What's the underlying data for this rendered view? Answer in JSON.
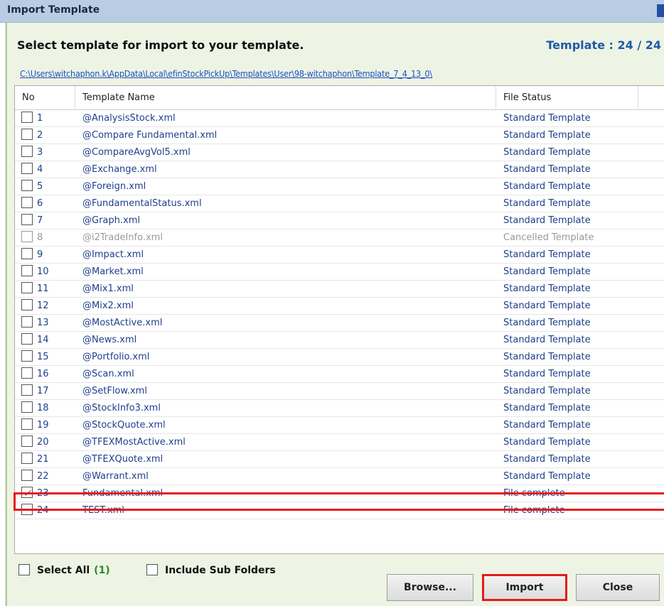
{
  "window": {
    "title": "Import Template"
  },
  "header": {
    "instruction": "Select template for import to your template.",
    "template_count": "Template : 24 / 24",
    "path": "C:\\Users\\witchaphon.k\\AppData\\Local\\efinStockPickUp\\Templates\\User\\98-witchaphon\\Template_7_4_13_0\\"
  },
  "table": {
    "columns": [
      "No",
      "Template Name",
      "File Status"
    ],
    "rows": [
      {
        "no": "1",
        "name": "@AnalysisStock.xml",
        "status": "Standard Template",
        "checked": false
      },
      {
        "no": "2",
        "name": "@Compare Fundamental.xml",
        "status": "Standard Template",
        "checked": false
      },
      {
        "no": "3",
        "name": "@CompareAvgVol5.xml",
        "status": "Standard Template",
        "checked": false
      },
      {
        "no": "4",
        "name": "@Exchange.xml",
        "status": "Standard Template",
        "checked": false
      },
      {
        "no": "5",
        "name": "@Foreign.xml",
        "status": "Standard Template",
        "checked": false
      },
      {
        "no": "6",
        "name": "@FundamentalStatus.xml",
        "status": "Standard Template",
        "checked": false
      },
      {
        "no": "7",
        "name": "@Graph.xml",
        "status": "Standard Template",
        "checked": false
      },
      {
        "no": "8",
        "name": "@i2TradeInfo.xml",
        "status": "Cancelled Template",
        "checked": false
      },
      {
        "no": "9",
        "name": "@Impact.xml",
        "status": "Standard Template",
        "checked": false
      },
      {
        "no": "10",
        "name": "@Market.xml",
        "status": "Standard Template",
        "checked": false
      },
      {
        "no": "11",
        "name": "@Mix1.xml",
        "status": "Standard Template",
        "checked": false
      },
      {
        "no": "12",
        "name": "@Mix2.xml",
        "status": "Standard Template",
        "checked": false
      },
      {
        "no": "13",
        "name": "@MostActive.xml",
        "status": "Standard Template",
        "checked": false
      },
      {
        "no": "14",
        "name": "@News.xml",
        "status": "Standard Template",
        "checked": false
      },
      {
        "no": "15",
        "name": "@Portfolio.xml",
        "status": "Standard Template",
        "checked": false
      },
      {
        "no": "16",
        "name": "@Scan.xml",
        "status": "Standard Template",
        "checked": false
      },
      {
        "no": "17",
        "name": "@SetFlow.xml",
        "status": "Standard Template",
        "checked": false
      },
      {
        "no": "18",
        "name": "@StockInfo3.xml",
        "status": "Standard Template",
        "checked": false
      },
      {
        "no": "19",
        "name": "@StockQuote.xml",
        "status": "Standard Template",
        "checked": false
      },
      {
        "no": "20",
        "name": "@TFEXMostActive.xml",
        "status": "Standard Template",
        "checked": false
      },
      {
        "no": "21",
        "name": "@TFEXQuote.xml",
        "status": "Standard Template",
        "checked": false
      },
      {
        "no": "22",
        "name": "@Warrant.xml",
        "status": "Standard Template",
        "checked": false
      },
      {
        "no": "23",
        "name": "Fundamental.xml",
        "status": "File complete",
        "checked": true
      },
      {
        "no": "24",
        "name": "TEST.xml",
        "status": "File complete",
        "checked": false
      }
    ]
  },
  "options": {
    "select_all_label": "Select All",
    "select_all_count": "(1)",
    "include_subfolders_label": "Include Sub Folders"
  },
  "buttons": {
    "browse": "Browse...",
    "import": "Import",
    "close": "Close"
  },
  "colors": {
    "highlight": "#e51b1b",
    "link": "#1c4fc4",
    "count": "#1e5aa8"
  }
}
